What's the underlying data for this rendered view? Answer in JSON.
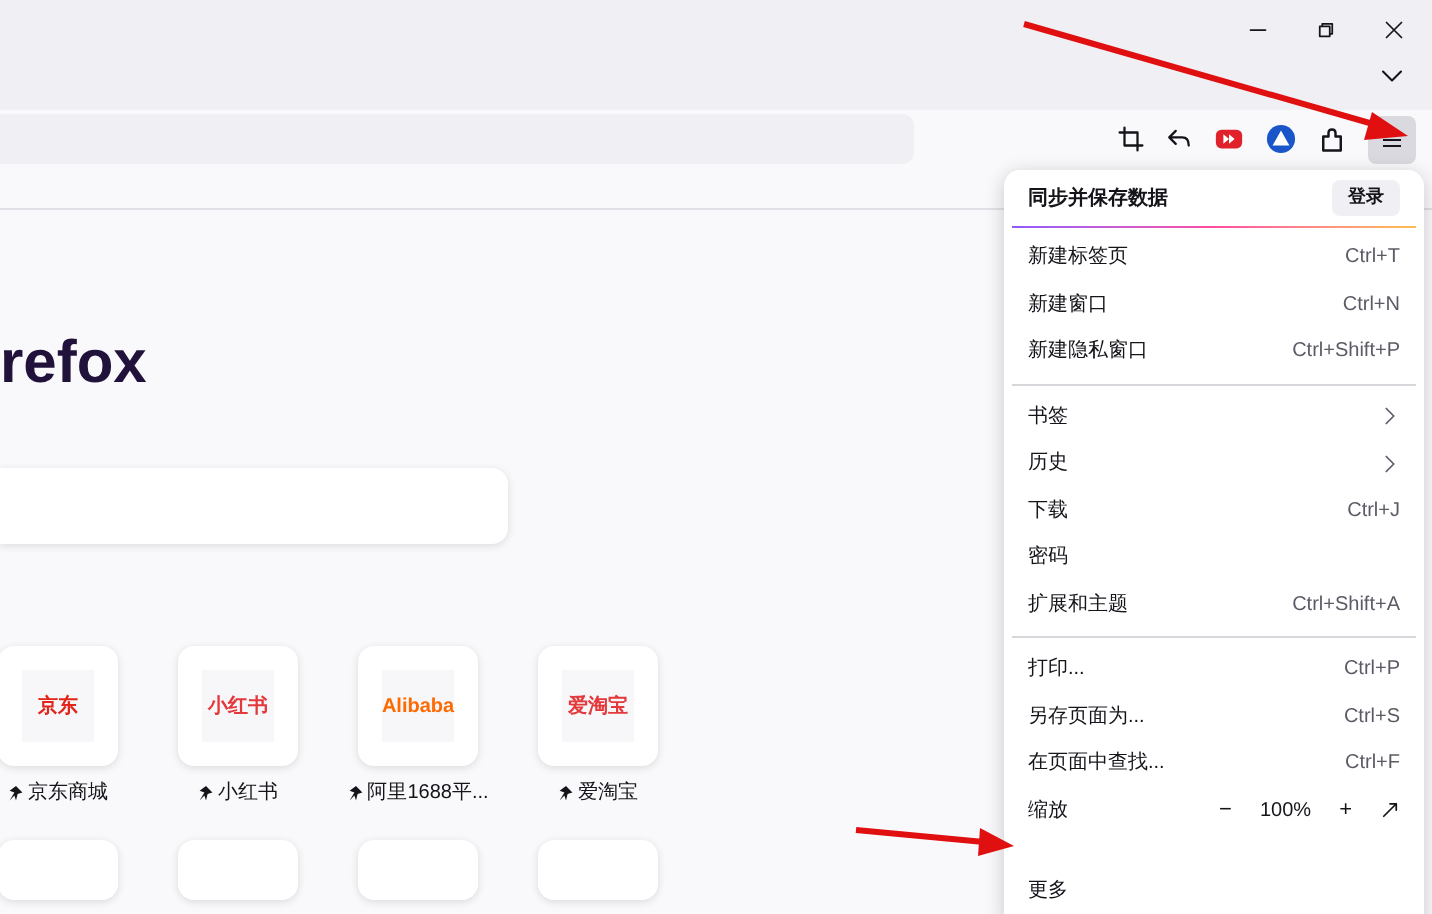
{
  "page": {
    "brand_text": "refox",
    "tiles": [
      {
        "label": "京东商城",
        "logo_text": "京东",
        "pinned": true
      },
      {
        "label": "小红书",
        "logo_text": "小红书",
        "pinned": true
      },
      {
        "label": "阿里1688平...",
        "logo_text": "Alibaba",
        "pinned": true
      },
      {
        "label": "爱淘宝",
        "logo_text": "爱淘宝",
        "pinned": true
      }
    ]
  },
  "menu": {
    "header": {
      "title": "同步并保存数据",
      "button": "登录"
    },
    "sections": [
      [
        {
          "kind": "item",
          "label": "新建标签页",
          "shortcut": "Ctrl+T"
        },
        {
          "kind": "item",
          "label": "新建窗口",
          "shortcut": "Ctrl+N"
        },
        {
          "kind": "item",
          "label": "新建隐私窗口",
          "shortcut": "Ctrl+Shift+P"
        }
      ],
      [
        {
          "kind": "submenu",
          "label": "书签"
        },
        {
          "kind": "submenu",
          "label": "历史"
        },
        {
          "kind": "item",
          "label": "下载",
          "shortcut": "Ctrl+J"
        },
        {
          "kind": "item",
          "label": "密码"
        },
        {
          "kind": "item",
          "label": "扩展和主题",
          "shortcut": "Ctrl+Shift+A"
        }
      ],
      [
        {
          "kind": "item",
          "label": "打印...",
          "shortcut": "Ctrl+P"
        },
        {
          "kind": "item",
          "label": "另存页面为...",
          "shortcut": "Ctrl+S"
        },
        {
          "kind": "item",
          "label": "在页面中查找...",
          "shortcut": "Ctrl+F"
        },
        {
          "kind": "zoom",
          "label": "缩放",
          "minus": "−",
          "value": "100%",
          "plus": "+"
        }
      ],
      [
        {
          "kind": "item",
          "label": "更多"
        }
      ]
    ]
  }
}
